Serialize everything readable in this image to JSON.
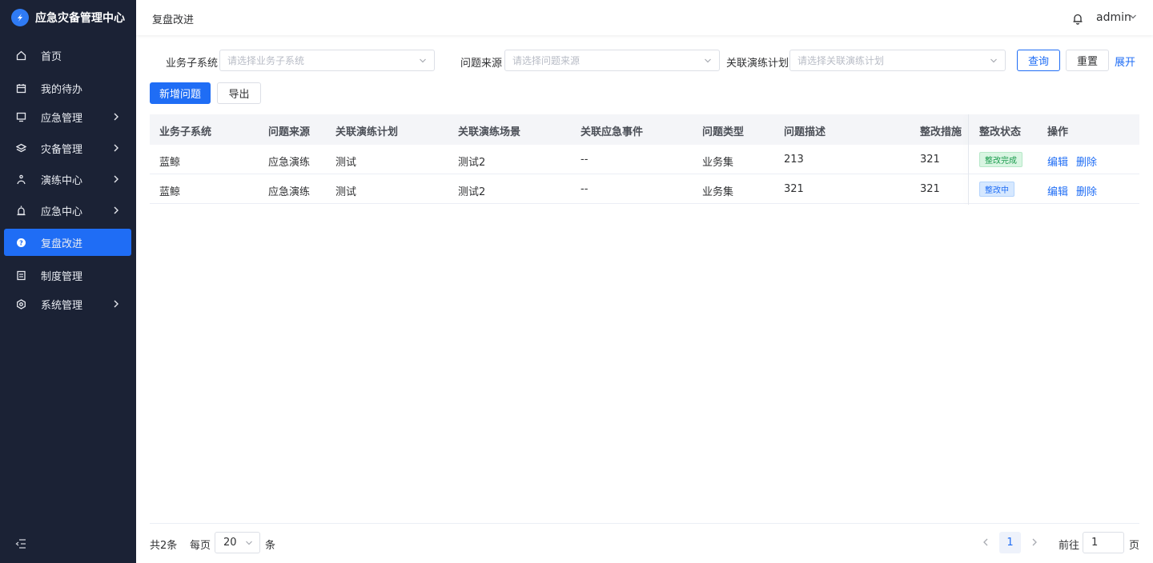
{
  "app": {
    "title": "应急灾备管理中心"
  },
  "sidebar": {
    "items": [
      {
        "label": "首页",
        "icon": "home-icon"
      },
      {
        "label": "我的待办",
        "icon": "calendar-icon"
      },
      {
        "label": "应急管理",
        "icon": "monitor-icon"
      },
      {
        "label": "灾备管理",
        "icon": "layers-icon"
      },
      {
        "label": "演练中心",
        "icon": "drill-icon"
      },
      {
        "label": "应急中心",
        "icon": "alarm-icon"
      },
      {
        "label": "复盘改进",
        "icon": "question-icon"
      },
      {
        "label": "制度管理",
        "icon": "document-icon"
      },
      {
        "label": "系统管理",
        "icon": "settings-icon"
      }
    ],
    "active_index": 6
  },
  "header": {
    "page_title": "复盘改进",
    "user": "admin"
  },
  "filters": {
    "subsystem_label": "业务子系统",
    "subsystem_placeholder": "请选择业务子系统",
    "source_label": "问题来源",
    "source_placeholder": "请选择问题来源",
    "plan_label": "关联演练计划",
    "plan_placeholder": "请选择关联演练计划",
    "query_label": "查询",
    "reset_label": "重置",
    "expand_label": "展开"
  },
  "actions": {
    "add_label": "新增问题",
    "export_label": "导出"
  },
  "table": {
    "columns": [
      "业务子系统",
      "问题来源",
      "关联演练计划",
      "关联演练场景",
      "关联应急事件",
      "问题类型",
      "问题描述",
      "整改措施",
      "整改状态",
      "操作"
    ],
    "rows": [
      {
        "subsystem": "蓝鲸",
        "source": "应急演练",
        "plan": "测试",
        "scene": "测试2",
        "event": "--",
        "type": "业务集",
        "desc": "213",
        "measure": "321",
        "status": "整改完成",
        "status_kind": "done",
        "edit": "编辑",
        "delete": "删除"
      },
      {
        "subsystem": "蓝鲸",
        "source": "应急演练",
        "plan": "测试",
        "scene": "测试2",
        "event": "--",
        "type": "业务集",
        "desc": "321",
        "measure": "321",
        "status": "整改中",
        "status_kind": "doing",
        "edit": "编辑",
        "delete": "删除"
      }
    ]
  },
  "pagination": {
    "total_text": "共2条",
    "per_page_prefix": "每页",
    "per_page_value": "20",
    "per_page_suffix": "条",
    "current_page": "1",
    "goto_prefix": "前往",
    "goto_value": "1",
    "goto_suffix": "页"
  },
  "colors": {
    "primary": "#1f6df5",
    "sidebar_bg": "#1b2235",
    "success": "#1c9c4e"
  }
}
